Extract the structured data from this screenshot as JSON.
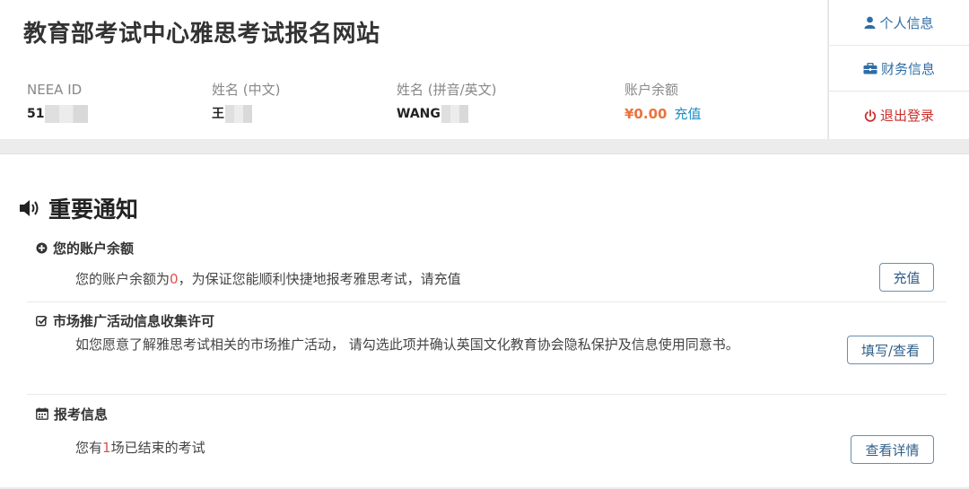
{
  "header": {
    "title": "教育部考试中心雅思考试报名网站",
    "fields": {
      "neea_label": "NEEA ID",
      "neea_value": "51",
      "cn_name_label": "姓名 (中文)",
      "cn_name_value": "王",
      "en_name_label": "姓名 (拼音/英文)",
      "en_name_value": "WANG",
      "balance_label": "账户余额",
      "balance_value": "¥0.00",
      "recharge_link": "充值"
    }
  },
  "side_menu": {
    "items": [
      {
        "label": "个人信息",
        "icon": "user-icon"
      },
      {
        "label": "财务信息",
        "icon": "briefcase-icon"
      },
      {
        "label": "退出登录",
        "icon": "power-icon"
      }
    ]
  },
  "notices": {
    "title": "重要通知",
    "account": {
      "heading": "您的账户余额",
      "text_before": "您的账户余额为",
      "amount": "0",
      "text_after": "，为保证您能顺利快捷地报考雅思考试，请充值",
      "button": "充值"
    },
    "marketing": {
      "heading": "市场推广活动信息收集许可",
      "text": "如您愿意了解雅思考试相关的市场推广活动， 请勾选此项并确认英国文化教育协会隐私保护及信息使用同意书。",
      "button": "填写/查看"
    },
    "registration": {
      "heading": "报考信息",
      "text_before": "您有",
      "count": "1",
      "text_after": "场已结束的考试",
      "button": "查看详情"
    }
  },
  "colors": {
    "link": "#1e8fc6",
    "balance": "#e8743c",
    "logout": "#c9302c",
    "highlight": "#d9534f"
  }
}
